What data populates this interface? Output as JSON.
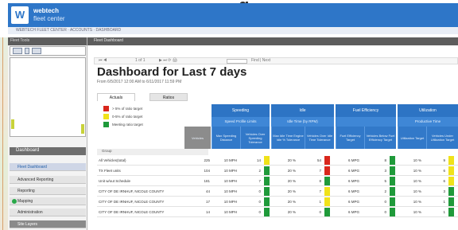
{
  "banner": {
    "title_fragment": "g"
  },
  "header": {
    "logo_text": "W",
    "brand_line1": "webtech",
    "brand_line2": "fleet center"
  },
  "urlbar": {
    "text": "WEBTECH FLEET CENTER · ACCOUNTS · DASHBOARD"
  },
  "sidebar": {
    "header": "Fleet Tools",
    "section_title": "Dashboard",
    "items": [
      {
        "label": "Fleet Dashboard",
        "active": true
      },
      {
        "label": "Advanced Reporting"
      },
      {
        "label": "Reporting"
      },
      {
        "label": "Mapping"
      },
      {
        "label": "Administration"
      },
      {
        "label": "Site Layers"
      }
    ]
  },
  "main": {
    "header": "Fleet Dashboard",
    "toolbar_left": "1 of 1",
    "toolbar_right": "Find | Next",
    "title": "Dashboard for Last 7 days",
    "subtitle": "From 6/5/2017 12:00 AM to 6/11/2017 11:59 PM",
    "tabs": [
      "Actuals",
      "Ratios"
    ],
    "legend": [
      {
        "color": "#d9261c",
        "label": "> 5% of ratio target"
      },
      {
        "color": "#f0e21a",
        "label": "0-5% of ratio target"
      },
      {
        "color": "#1f9a3a",
        "label": "Meeting ratio target"
      }
    ],
    "groups": [
      {
        "title": "Speeding",
        "sub": "Speed Profile Limits"
      },
      {
        "title": "Idle",
        "sub": "Idle Time (by RPM)"
      },
      {
        "title": "Fuel Efficiency",
        "sub": ""
      },
      {
        "title": "Utilization",
        "sub": "Productive Time"
      }
    ],
    "columns": [
      "Vehicles",
      "Max Speeding Distance",
      "Vehicles Over Speeding Tolerance",
      "Max Idle Time Engine Idle % Tolerance",
      "Vehicles Over Idle Time Tolerance",
      "Fuel Efficiency Target",
      "Vehicles Below Fuel Efficiency Target",
      "Utilization Target",
      "Vehicles Under Utilization Target"
    ],
    "row_label_header": "Group",
    "rows": [
      {
        "label": "All Vehicles(total)",
        "vehicles": "225",
        "v1": "10 MPH",
        "v2": "14",
        "v3": "20 %",
        "v4": "54",
        "v5": "6 MPG",
        "v6": "8",
        "v7": "10 %",
        "v8": "9"
      },
      {
        "label": "TX Fleet units",
        "vehicles": "104",
        "v1": "10 MPH",
        "v2": "2",
        "v3": "20 %",
        "v4": "7",
        "v5": "6 MPG",
        "v6": "3",
        "v7": "10 %",
        "v8": "6"
      },
      {
        "label": "Unit w/out Schedule",
        "vehicles": "181",
        "v1": "10 MPH",
        "v2": "7",
        "v3": "20 %",
        "v4": "8",
        "v5": "6 MPG",
        "v6": "5",
        "v7": "10 %",
        "v8": "6"
      },
      {
        "label": "CITY OF DE IRNHUF, NICOLE COUNTY",
        "vehicles": "44",
        "v1": "10 MPH",
        "v2": "0",
        "v3": "20 %",
        "v4": "7",
        "v5": "6 MPG",
        "v6": "2",
        "v7": "10 %",
        "v8": "3"
      },
      {
        "label": "CITY OF DE IRNHUF, NICOLE COUNTY",
        "vehicles": "17",
        "v1": "10 MPH",
        "v2": "0",
        "v3": "20 %",
        "v4": "1",
        "v5": "6 MPG",
        "v6": "0",
        "v7": "10 %",
        "v8": "1"
      },
      {
        "label": "CITY OF DE IRNHUF, NICOLE COUNTY",
        "vehicles": "14",
        "v1": "10 MPH",
        "v2": "0",
        "v3": "20 %",
        "v4": "0",
        "v5": "6 MPG",
        "v6": "0",
        "v7": "10 %",
        "v8": "1"
      }
    ]
  },
  "colors": {
    "accent": "#2e76c8",
    "red": "#d9261c",
    "yellow": "#f0e21a",
    "green": "#1f9a3a"
  }
}
